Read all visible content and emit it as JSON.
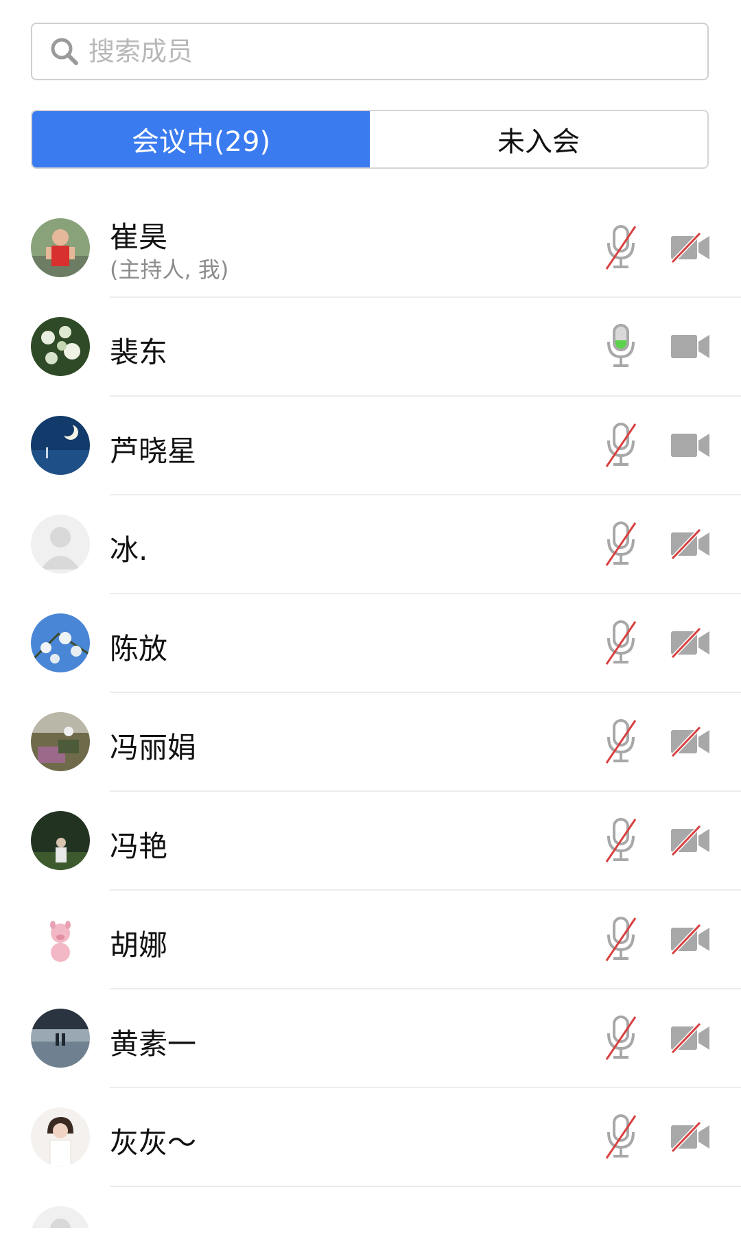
{
  "search": {
    "placeholder": "搜索成员"
  },
  "tabs": [
    {
      "label": "会议中(29)",
      "active": true
    },
    {
      "label": "未入会",
      "active": false
    }
  ],
  "colors": {
    "accent": "#3b7bf0",
    "muted_red": "#d84040",
    "icon_gray": "#a8a8a8",
    "speaking_green": "#5ad24a"
  },
  "members": [
    {
      "name": "崔昊",
      "subtitle": "(主持人, 我)",
      "mic": "muted",
      "camera": "off",
      "avatar": "child-photo-red"
    },
    {
      "name": "裴东",
      "subtitle": "",
      "mic": "speaking",
      "camera": "on",
      "avatar": "flowers-photo-green"
    },
    {
      "name": "芦晓星",
      "subtitle": "",
      "mic": "muted",
      "camera": "on",
      "avatar": "moon-night-photo"
    },
    {
      "name": "冰.",
      "subtitle": "",
      "mic": "muted",
      "camera": "off",
      "avatar": "default-avatar"
    },
    {
      "name": "陈放",
      "subtitle": "",
      "mic": "muted",
      "camera": "off",
      "avatar": "blossom-sky-photo"
    },
    {
      "name": "冯丽娟",
      "subtitle": "",
      "mic": "muted",
      "camera": "off",
      "avatar": "outdoor-photo"
    },
    {
      "name": "冯艳",
      "subtitle": "",
      "mic": "muted",
      "camera": "off",
      "avatar": "forest-person-photo"
    },
    {
      "name": "胡娜",
      "subtitle": "",
      "mic": "muted",
      "camera": "off",
      "avatar": "pink-pig-cartoon"
    },
    {
      "name": "黄素一",
      "subtitle": "",
      "mic": "muted",
      "camera": "off",
      "avatar": "lake-photo"
    },
    {
      "name": "灰灰～",
      "subtitle": "",
      "mic": "muted",
      "camera": "off",
      "avatar": "woman-white-photo"
    }
  ]
}
